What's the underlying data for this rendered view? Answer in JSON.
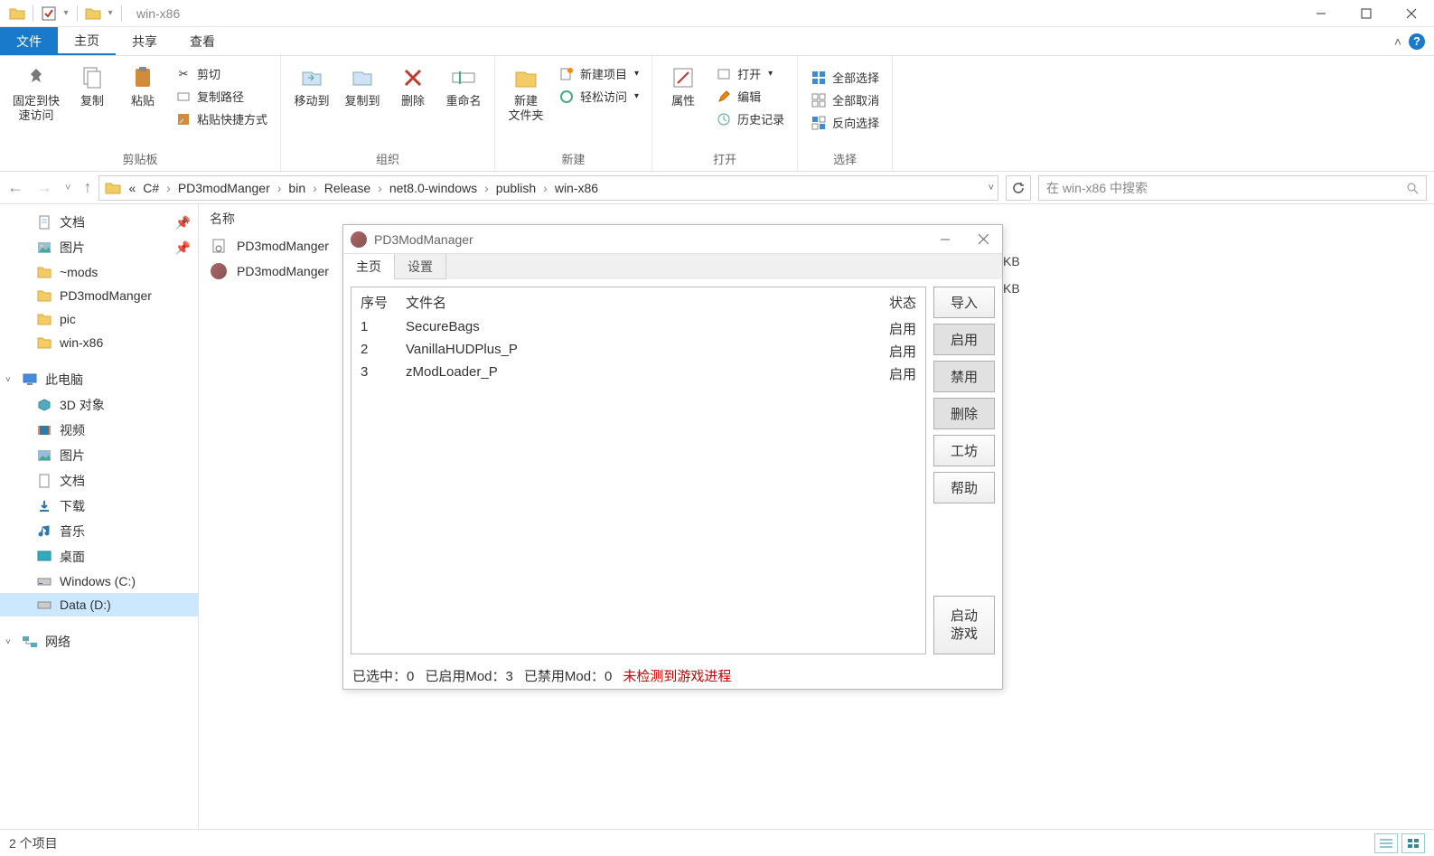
{
  "titlebar": {
    "title": "win-x86"
  },
  "ribbon": {
    "tabs": {
      "file": "文件",
      "home": "主页",
      "share": "共享",
      "view": "查看"
    },
    "groups": {
      "clipboard": {
        "label": "剪贴板",
        "pin": "固定到快\n速访问",
        "copy": "复制",
        "paste": "粘贴",
        "cut": "剪切",
        "copy_path": "复制路径",
        "paste_shortcut": "粘贴快捷方式"
      },
      "organize": {
        "label": "组织",
        "move_to": "移动到",
        "copy_to": "复制到",
        "delete": "删除",
        "rename": "重命名"
      },
      "new": {
        "label": "新建",
        "new_folder": "新建\n文件夹",
        "new_item": "新建项目",
        "easy_access": "轻松访问"
      },
      "open": {
        "label": "打开",
        "properties": "属性",
        "open": "打开",
        "edit": "编辑",
        "history": "历史记录"
      },
      "select": {
        "label": "选择",
        "select_all": "全部选择",
        "select_none": "全部取消",
        "invert": "反向选择"
      }
    }
  },
  "breadcrumb": [
    "C#",
    "PD3modManger",
    "bin",
    "Release",
    "net8.0-windows",
    "publish",
    "win-x86"
  ],
  "breadcrumb_prefix": "«",
  "search": {
    "placeholder": "在 win-x86 中搜索"
  },
  "sidebar": {
    "items": [
      {
        "label": "文档",
        "pinned": true
      },
      {
        "label": "图片",
        "pinned": true
      },
      {
        "label": "~mods"
      },
      {
        "label": "PD3modManger"
      },
      {
        "label": "pic"
      },
      {
        "label": "win-x86"
      }
    ],
    "this_pc": "此电脑",
    "pc_items": [
      {
        "label": "3D 对象"
      },
      {
        "label": "视频"
      },
      {
        "label": "图片"
      },
      {
        "label": "文档"
      },
      {
        "label": "下载"
      },
      {
        "label": "音乐"
      },
      {
        "label": "桌面"
      },
      {
        "label": "Windows (C:)"
      },
      {
        "label": "Data (D:)",
        "selected": true
      }
    ],
    "network": "网络"
  },
  "files": {
    "header_name": "名称",
    "rows": [
      {
        "name": "PD3modManger"
      },
      {
        "name": "PD3modManger"
      }
    ],
    "kb_suffix": "KB"
  },
  "app": {
    "title": "PD3ModManager",
    "tabs": {
      "main": "主页",
      "settings": "设置"
    },
    "columns": {
      "idx": "序号",
      "file": "文件名",
      "status": "状态"
    },
    "mods": [
      {
        "idx": "1",
        "name": "SecureBags",
        "status": "启用"
      },
      {
        "idx": "2",
        "name": "VanillaHUDPlus_P",
        "status": "启用"
      },
      {
        "idx": "3",
        "name": "zModLoader_P",
        "status": "启用"
      }
    ],
    "buttons": {
      "import": "导入",
      "enable": "启用",
      "disable": "禁用",
      "delete": "删除",
      "workshop": "工坊",
      "help": "帮助",
      "launch": "启动\n游戏"
    },
    "status": {
      "selected": "已选中：0",
      "enabled": "已启用Mod：3",
      "disabled": "已禁用Mod：0",
      "warn": "未检测到游戏进程"
    }
  },
  "statusbar": {
    "items": "2 个项目"
  }
}
